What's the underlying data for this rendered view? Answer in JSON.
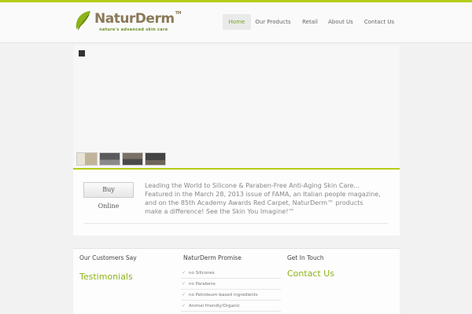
{
  "brand": {
    "name": "NaturDerm",
    "trademark": "TM",
    "tagline": "nature's advanced skin care",
    "accent_color": "#b5cc18"
  },
  "nav": {
    "items": [
      {
        "label": "Home",
        "active": true
      },
      {
        "label": "Our Products"
      },
      {
        "label": "Retail"
      },
      {
        "label": "About Us"
      },
      {
        "label": "Contact Us"
      }
    ]
  },
  "slider": {
    "control_icon": "stop-square-icon",
    "thumbnails": [
      "slide-1",
      "slide-2",
      "slide-3",
      "slide-4"
    ]
  },
  "intro": {
    "buy_label": "Buy",
    "online_label": "Online",
    "text": "Leading the World to Silicone & Paraben-Free Anti-Aging Skin Care... Featured in the March 28, 2013 issue of FAMA, an Italian people magazine, and on the 85th Academy Awards Red Carpet, NaturDerm™ products make a difference! See the Skin You Imagine!™"
  },
  "widgets": {
    "customers": {
      "heading": "Our Customers Say",
      "link": "Testimonials"
    },
    "promise": {
      "heading": "NaturDerm Promise",
      "items": [
        "no Silicones",
        "no Parabens",
        "no Petroleum-based ingredients",
        "Animal friendly/Organic"
      ]
    },
    "contact": {
      "heading": "Get In Touch",
      "link": "Contact Us"
    }
  }
}
